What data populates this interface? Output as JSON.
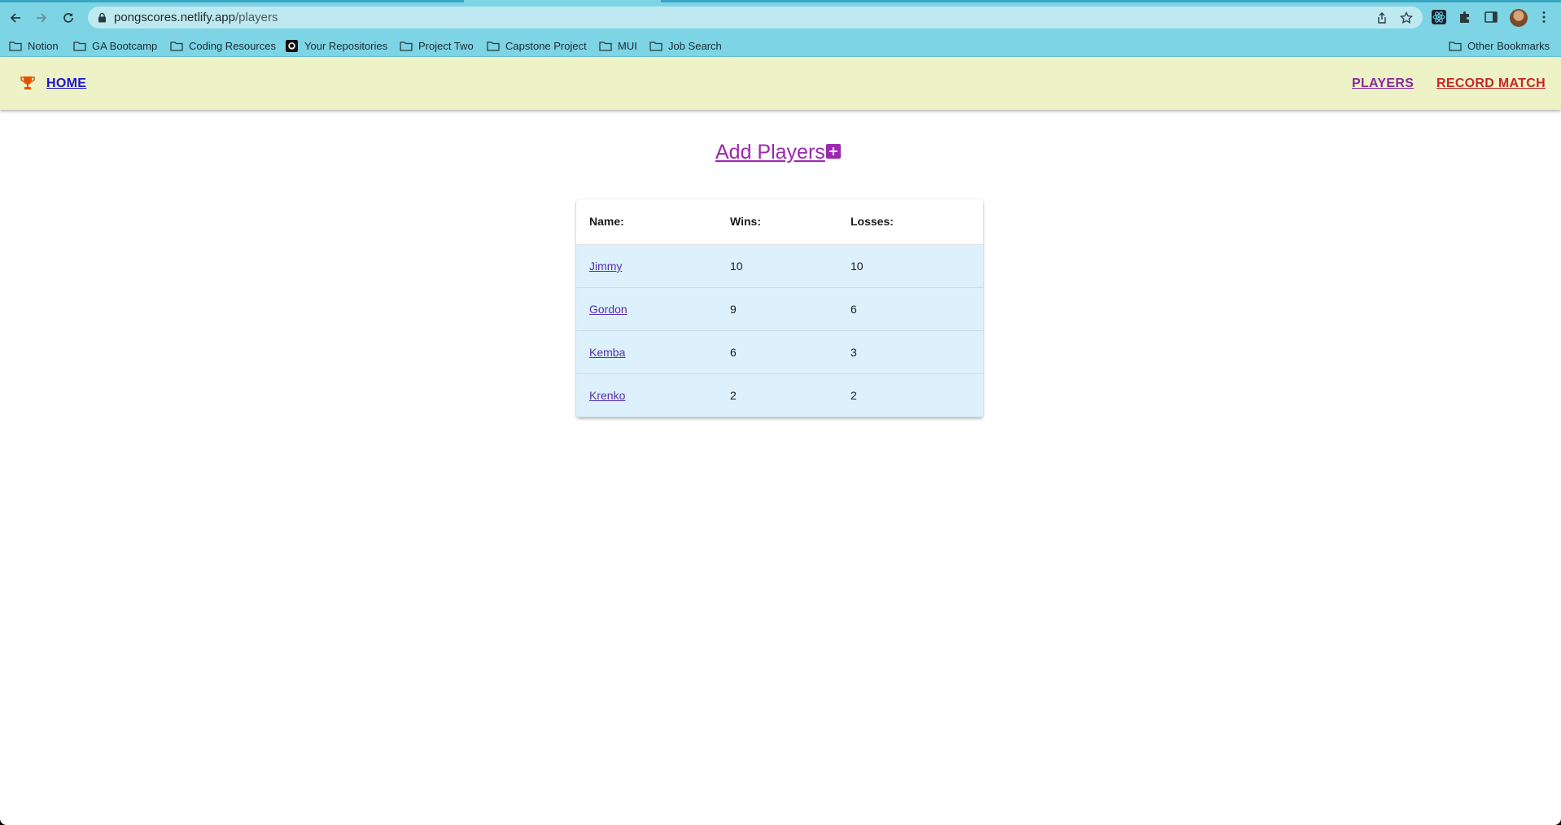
{
  "browser": {
    "url_host": "pongscores.netlify.app",
    "url_path": "/players",
    "bookmarks": [
      {
        "label": "Notion",
        "icon": "folder-icon"
      },
      {
        "label": "GA Bootcamp",
        "icon": "folder-icon"
      },
      {
        "label": "Coding Resources",
        "icon": "folder-icon"
      },
      {
        "label": "Your Repositories",
        "icon": "github-icon"
      },
      {
        "label": "Project Two",
        "icon": "folder-icon"
      },
      {
        "label": "Capstone Project",
        "icon": "folder-icon"
      },
      {
        "label": "MUI",
        "icon": "folder-icon"
      },
      {
        "label": "Job Search",
        "icon": "folder-icon"
      }
    ],
    "other_bookmarks": "Other Bookmarks",
    "chrome_color": "#7dd4e4"
  },
  "nav": {
    "home": "HOME",
    "players": "PLAYERS",
    "record_match": "RECORD MATCH",
    "bar_color": "#eef2c7"
  },
  "main": {
    "add_players": "Add Players",
    "table": {
      "headers": [
        "Name:",
        "Wins:",
        "Losses:"
      ],
      "rows": [
        {
          "name": "Jimmy",
          "wins": "10",
          "losses": "10"
        },
        {
          "name": "Gordon",
          "wins": "9",
          "losses": "6"
        },
        {
          "name": "Kemba",
          "wins": "6",
          "losses": "3"
        },
        {
          "name": "Krenko",
          "wins": "2",
          "losses": "2"
        }
      ]
    },
    "accent_color": "#9c27b0"
  }
}
